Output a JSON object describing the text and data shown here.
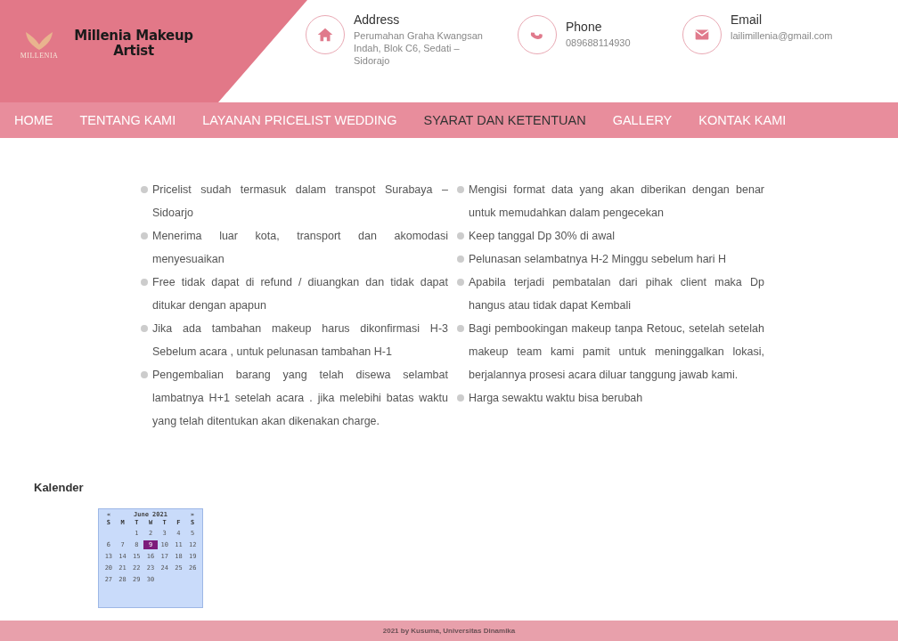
{
  "brand": {
    "logo_caption": "MILLENIA",
    "name": "Millenia Makeup Artist"
  },
  "contacts": [
    {
      "kind": "home",
      "label": "Address",
      "value": "Perumahan Graha Kwangsan Indah, Blok C6, Sedati – Sidorajo"
    },
    {
      "kind": "phone",
      "label": "Phone",
      "value": "089688114930"
    },
    {
      "kind": "mail",
      "label": "Email",
      "value": "lailimillenia@gmail.com"
    }
  ],
  "nav": [
    {
      "label": "HOME",
      "selected": false
    },
    {
      "label": "TENTANG KAMI",
      "selected": false
    },
    {
      "label": "LAYANAN PRICELIST WEDDING",
      "selected": false
    },
    {
      "label": "SYARAT DAN KETENTUAN",
      "selected": true
    },
    {
      "label": "GALLERY",
      "selected": false
    },
    {
      "label": "KONTAK KAMI",
      "selected": false
    }
  ],
  "terms": [
    [
      "Pricelist sudah termasuk dalam transpot Surabaya – Sidoarjo",
      "Menerima luar kota, transport dan akomodasi menyesuaikan",
      "Free tidak dapat di refund / diuangkan dan tidak dapat ditukar dengan apapun",
      "Jika ada tambahan makeup harus dikonfirmasi H-3 Sebelum acara , untuk pelunasan tambahan H-1",
      "Pengembalian barang yang telah disewa selambat lambatnya H+1 setelah acara . jika melebihi batas waktu yang telah ditentukan akan dikenakan charge."
    ],
    [
      "Mengisi format data yang akan diberikan dengan benar untuk memudahkan dalam pengecekan",
      "Keep tanggal Dp 30% di awal",
      "Pelunasan selambatnya H-2 Minggu sebelum hari H",
      "Apabila terjadi pembatalan dari pihak client maka Dp hangus atau tidak dapat Kembali",
      "Bagi pembookingan makeup tanpa Retouc, setelah setelah makeup team kami pamit untuk meninggalkan lokasi, berjalannya prosesi acara diluar tanggung jawab kami.",
      "Harga sewaktu waktu bisa berubah"
    ]
  ],
  "calendar": {
    "title": "Kalender",
    "prev": "«",
    "month": "June 2021",
    "next": "»",
    "weekdays": [
      "S",
      "M",
      "T",
      "W",
      "T",
      "F",
      "S"
    ],
    "weeks": [
      [
        {
          "day": "1",
          "selected": false
        },
        {
          "day": "2",
          "selected": false
        },
        {
          "day": "3",
          "selected": false
        },
        {
          "day": "4",
          "selected": false
        },
        {
          "day": "5",
          "selected": false
        }
      ],
      [
        {
          "day": "6",
          "selected": false
        },
        {
          "day": "7",
          "selected": false
        },
        {
          "day": "8",
          "selected": false
        },
        {
          "day": "9",
          "selected": true
        },
        {
          "day": "10",
          "selected": false
        },
        {
          "day": "11",
          "selected": false
        },
        {
          "day": "12",
          "selected": false
        }
      ],
      [
        {
          "day": "13",
          "selected": false
        },
        {
          "day": "14",
          "selected": false
        },
        {
          "day": "15",
          "selected": false
        },
        {
          "day": "16",
          "selected": false
        },
        {
          "day": "17",
          "selected": false
        },
        {
          "day": "18",
          "selected": false
        },
        {
          "day": "19",
          "selected": false
        }
      ],
      [
        {
          "day": "20",
          "selected": false
        },
        {
          "day": "21",
          "selected": false
        },
        {
          "day": "22",
          "selected": false
        },
        {
          "day": "23",
          "selected": false
        },
        {
          "day": "24",
          "selected": false
        },
        {
          "day": "25",
          "selected": false
        },
        {
          "day": "26",
          "selected": false
        }
      ],
      [
        {
          "day": "27",
          "selected": false
        },
        {
          "day": "28",
          "selected": false
        },
        {
          "day": "29",
          "selected": false
        },
        {
          "day": "30",
          "selected": false
        }
      ]
    ]
  },
  "footer": "2021 by Kusuma, Universitas Dinamika"
}
